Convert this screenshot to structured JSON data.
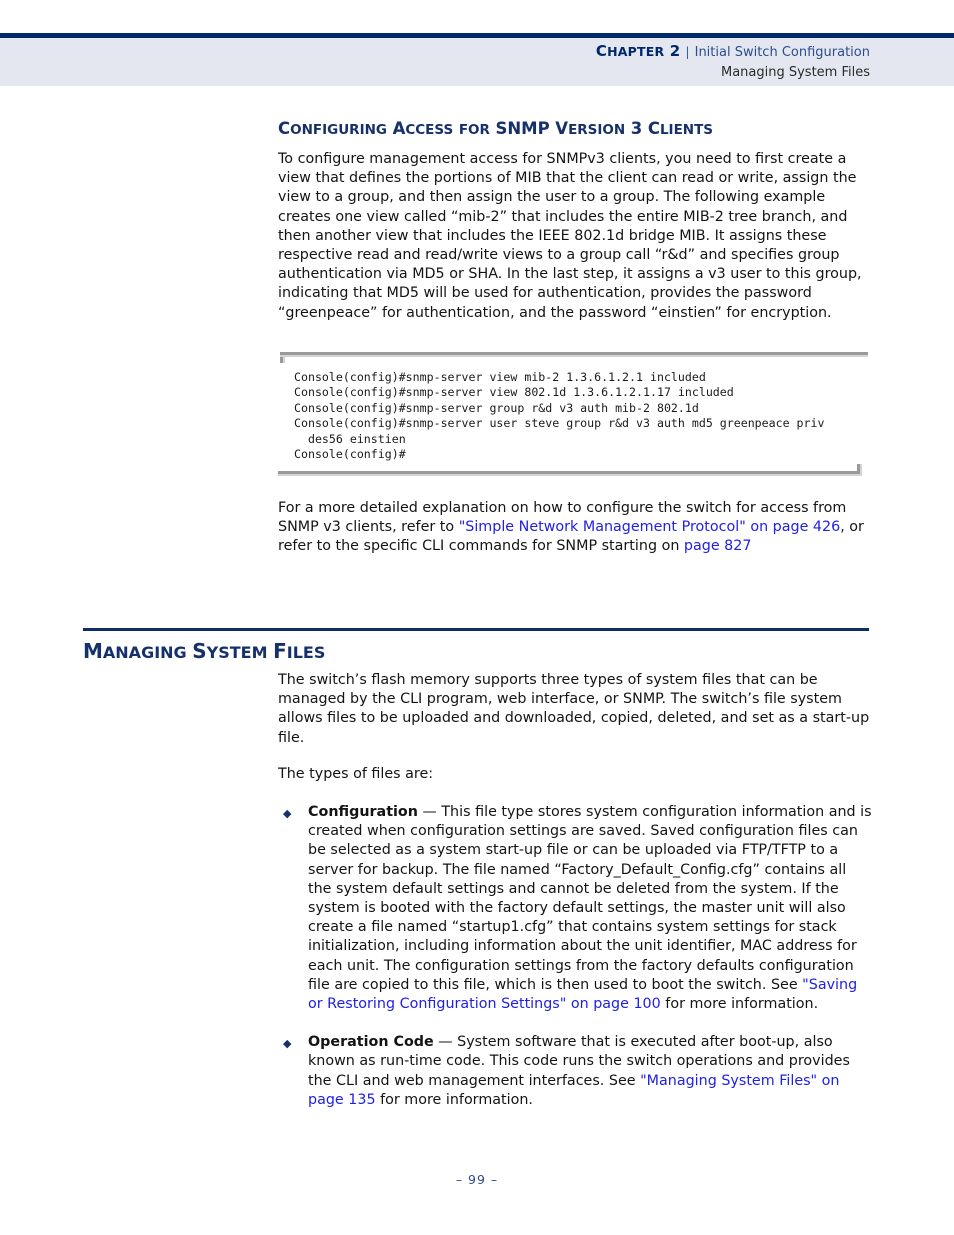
{
  "header": {
    "chapter_label_first": "C",
    "chapter_label_rest": "hapter",
    "chapter_number": "2",
    "separator": "|",
    "chapter_name": "Initial Switch Configuration",
    "section_name": "Managing System Files"
  },
  "section_heading": {
    "parts": [
      {
        "cap": "C",
        "rest": "onfiguring"
      },
      {
        "cap": "A",
        "rest": "ccess"
      },
      {
        "cap": "",
        "rest": "for"
      },
      {
        "cap": "SNMP",
        "rest": ""
      },
      {
        "cap": "V",
        "rest": "ersion"
      },
      {
        "cap": "3",
        "rest": ""
      },
      {
        "cap": "C",
        "rest": "lients"
      }
    ],
    "plain": "Configuring Access for SNMP Version 3 Clients"
  },
  "paragraph_1": "To configure management access for SNMPv3 clients, you need to first create a view that defines the portions of MIB that the client can read or write, assign the view to a group, and then assign the user to a group. The following example creates one view called “mib-2” that includes the entire MIB-2 tree branch, and then another view that includes the IEEE 802.1d bridge MIB. It assigns these respective read and read/write views to a group call “r&d” and specifies group authentication via MD5 or SHA. In the last step, it assigns a v3 user to this group, indicating that MD5 will be used for authentication, provides the password “greenpeace” for authentication, and the password “einstien” for encryption.",
  "code_block": {
    "lines": [
      "Console(config)#snmp-server view mib-2 1.3.6.1.2.1 included",
      "Console(config)#snmp-server view 802.1d 1.3.6.1.2.1.17 included",
      "Console(config)#snmp-server group r&d v3 auth mib-2 802.1d",
      "Console(config)#snmp-server user steve group r&d v3 auth md5 greenpeace priv",
      "  des56 einstien",
      "Console(config)#"
    ],
    "text": "Console(config)#snmp-server view mib-2 1.3.6.1.2.1 included\nConsole(config)#snmp-server view 802.1d 1.3.6.1.2.1.17 included\nConsole(config)#snmp-server group r&d v3 auth mib-2 802.1d\nConsole(config)#snmp-server user steve group r&d v3 auth md5 greenpeace priv\n  des56 einstien\nConsole(config)#"
  },
  "paragraph_2": {
    "before_link": "For a more detailed explanation on how to configure the switch for access from SNMP v3 clients, refer to ",
    "link_1": "\"Simple Network Management Protocol\" on page 426",
    "middle": ", or refer to the specific CLI commands for SNMP starting on ",
    "link_2": "page 827"
  },
  "managing_heading": {
    "plain": "Managing System Files",
    "parts": [
      {
        "cap": "M",
        "rest": "anaging"
      },
      {
        "cap": "S",
        "rest": "ystem"
      },
      {
        "cap": "F",
        "rest": "iles"
      }
    ]
  },
  "paragraph_3": "The switch’s flash memory supports three types of system files that can be managed by the CLI program, web interface, or SNMP. The switch’s file system allows files to be uploaded and downloaded, copied, deleted, and set as a start-up file.",
  "paragraph_4": "The types of files are:",
  "bullets": [
    {
      "marker": "◆",
      "term": "Configuration",
      "dash": " — ",
      "before_link": "This file type stores system configuration information and is created when configuration settings are saved. Saved configuration files can be selected as a system start-up file or can be uploaded via FTP/TFTP to a server for backup. The file named “Factory_Default_Config.cfg” contains all the system default settings and cannot be deleted from the system. If the system is booted with the factory default settings, the master unit will also create a file named “startup1.cfg” that contains system settings for stack initialization, including information about the unit identifier, MAC address for each unit. The configuration settings from the factory defaults configuration file are copied to this file, which is then used to boot the switch. See ",
      "link": "\"Saving or Restoring Configuration Settings\" on page 100",
      "after_link": " for more information."
    },
    {
      "marker": "◆",
      "term": "Operation Code",
      "dash": " — ",
      "before_link": "System software that is executed after boot-up, also known as run-time code. This code runs the switch operations and provides the CLI and web management interfaces. See ",
      "link": "\"Managing System Files\" on page 135",
      "after_link": " for more information."
    }
  ],
  "footer": {
    "page_number": "–  99  –"
  },
  "colors": {
    "navy": "#00296b",
    "heading_navy": "#15306b",
    "header_band": "#e4e7ef",
    "link_blue": "#2020e6",
    "header_chapter_blue": "#2c4d8e",
    "code_rule": "#9a9a9a"
  }
}
